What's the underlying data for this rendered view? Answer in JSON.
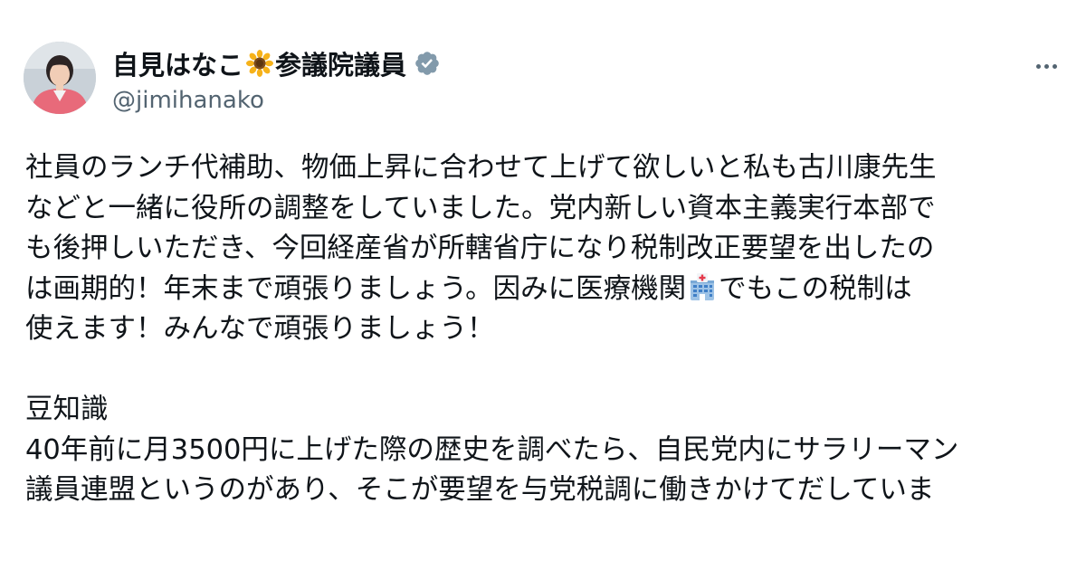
{
  "post": {
    "author": {
      "display_name": "自見はなこ",
      "name_emoji": "sunflower-icon",
      "title_suffix": "参議院議員",
      "handle": "@jimihanako",
      "verified": true
    },
    "more_label": "More",
    "paragraph1": {
      "l1": "社員のランチ代補助、物価上昇に合わせて上げて欲しいと私も古川康先生",
      "l2": "などと一緒に役所の調整をしていました。党内新しい資本主義実行本部で",
      "l3": "も後押しいただき、今回経産省が所轄省庁になり税制改正要望を出したの",
      "l4a": "は画期的！年末まで頑張りましょう。因みに医療機関",
      "l4_emoji": "hospital-icon",
      "l4b": "でもこの税制は",
      "l5": "使えます！みんなで頑張りましょう！"
    },
    "paragraph2": {
      "heading": "豆知識",
      "l1": "40年前に月3500円に上げた際の歴史を調べたら、自民党内にサラリーマン",
      "l2": "議員連盟というのがあり、そこが要望を与党税調に働きかけてだしていま"
    }
  },
  "colors": {
    "text": "#0f1419",
    "secondary": "#536471",
    "verified_badge": "#829aab",
    "background": "#ffffff"
  }
}
